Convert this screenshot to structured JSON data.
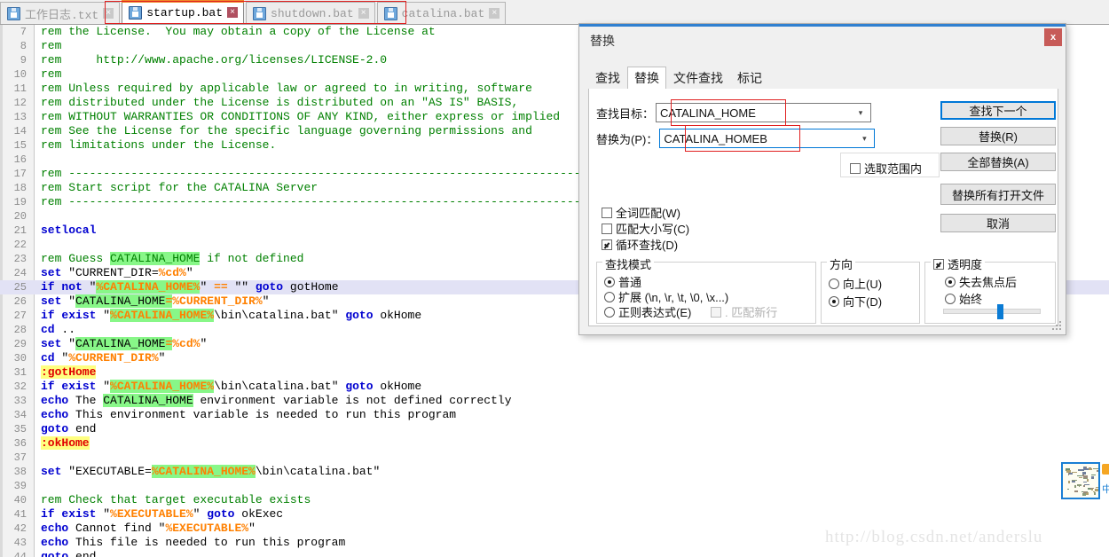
{
  "tabs": [
    {
      "label": "工作日志.txt",
      "active": false,
      "close": "×"
    },
    {
      "label": "startup.bat",
      "active": true,
      "close": "×"
    },
    {
      "label": "shutdown.bat",
      "active": false,
      "close": "×"
    },
    {
      "label": "catalina.bat",
      "active": false,
      "close": "×"
    }
  ],
  "editor": {
    "lines": [
      {
        "num": "7",
        "segs": [
          {
            "t": "rem the License.  You may obtain a copy of the License at",
            "c": "cm"
          }
        ]
      },
      {
        "num": "8",
        "segs": [
          {
            "t": "rem",
            "c": "cm"
          }
        ]
      },
      {
        "num": "9",
        "segs": [
          {
            "t": "rem     http://www.apache.org/licenses/LICENSE-2.0",
            "c": "cm"
          }
        ]
      },
      {
        "num": "10",
        "segs": [
          {
            "t": "rem",
            "c": "cm"
          }
        ]
      },
      {
        "num": "11",
        "segs": [
          {
            "t": "rem Unless required by applicable law or agreed to in writing, software",
            "c": "cm"
          }
        ]
      },
      {
        "num": "12",
        "segs": [
          {
            "t": "rem distributed under the License is distributed on an \"AS IS\" BASIS,",
            "c": "cm"
          }
        ]
      },
      {
        "num": "13",
        "segs": [
          {
            "t": "rem WITHOUT WARRANTIES OR CONDITIONS OF ANY KIND, either express or implied",
            "c": "cm"
          }
        ]
      },
      {
        "num": "14",
        "segs": [
          {
            "t": "rem See the License for the specific language governing permissions and",
            "c": "cm"
          }
        ]
      },
      {
        "num": "15",
        "segs": [
          {
            "t": "rem limitations under the License.",
            "c": "cm"
          }
        ]
      },
      {
        "num": "16",
        "segs": []
      },
      {
        "num": "17",
        "segs": [
          {
            "t": "rem ---------------------------------------------------------------------------",
            "c": "cm"
          }
        ]
      },
      {
        "num": "18",
        "segs": [
          {
            "t": "rem Start script for the CATALINA Server",
            "c": "cm"
          }
        ]
      },
      {
        "num": "19",
        "segs": [
          {
            "t": "rem ---------------------------------------------------------------------------",
            "c": "cm"
          }
        ]
      },
      {
        "num": "20",
        "segs": []
      },
      {
        "num": "21",
        "segs": [
          {
            "t": "setlocal",
            "c": "kw"
          }
        ]
      },
      {
        "num": "22",
        "segs": []
      },
      {
        "num": "23",
        "segs": [
          {
            "t": "rem Guess ",
            "c": "cm"
          },
          {
            "t": "CATALINA_HOME",
            "c": "cm hit"
          },
          {
            "t": " if not defined",
            "c": "cm"
          }
        ]
      },
      {
        "num": "24",
        "segs": [
          {
            "t": "set",
            "c": "kw"
          },
          {
            "t": " \"CURRENT_DIR=",
            "c": "plain"
          },
          {
            "t": "%cd%",
            "c": "var"
          },
          {
            "t": "\"",
            "c": "plain"
          }
        ]
      },
      {
        "num": "25",
        "current": true,
        "segs": [
          {
            "t": "if",
            "c": "kw"
          },
          {
            "t": " ",
            "c": "plain"
          },
          {
            "t": "not",
            "c": "kw"
          },
          {
            "t": " \"",
            "c": "plain"
          },
          {
            "t": "%CATALINA_HOME%",
            "c": "var hit"
          },
          {
            "t": "\" ",
            "c": "plain"
          },
          {
            "t": "==",
            "c": "var"
          },
          {
            "t": " \"\" ",
            "c": "plain"
          },
          {
            "t": "goto",
            "c": "kw"
          },
          {
            "t": " gotHome",
            "c": "plain"
          }
        ]
      },
      {
        "num": "26",
        "segs": [
          {
            "t": "set",
            "c": "kw"
          },
          {
            "t": " \"",
            "c": "plain"
          },
          {
            "t": "CATALINA_HOME",
            "c": "plain hit"
          },
          {
            "t": "=",
            "c": "var hit"
          },
          {
            "t": "%CURRENT_DIR%",
            "c": "var"
          },
          {
            "t": "\"",
            "c": "plain"
          }
        ]
      },
      {
        "num": "27",
        "segs": [
          {
            "t": "if",
            "c": "kw"
          },
          {
            "t": " ",
            "c": "plain"
          },
          {
            "t": "exist",
            "c": "kw"
          },
          {
            "t": " \"",
            "c": "plain"
          },
          {
            "t": "%CATALINA_HOME%",
            "c": "var hit"
          },
          {
            "t": "\\bin\\catalina.bat\" ",
            "c": "plain"
          },
          {
            "t": "goto",
            "c": "kw"
          },
          {
            "t": " okHome",
            "c": "plain"
          }
        ]
      },
      {
        "num": "28",
        "segs": [
          {
            "t": "cd",
            "c": "kw"
          },
          {
            "t": " ..",
            "c": "plain"
          }
        ]
      },
      {
        "num": "29",
        "segs": [
          {
            "t": "set",
            "c": "kw"
          },
          {
            "t": " \"",
            "c": "plain"
          },
          {
            "t": "CATALINA_HOME",
            "c": "plain hit"
          },
          {
            "t": "=",
            "c": "var hit"
          },
          {
            "t": "%cd%",
            "c": "var"
          },
          {
            "t": "\"",
            "c": "plain"
          }
        ]
      },
      {
        "num": "30",
        "segs": [
          {
            "t": "cd",
            "c": "kw"
          },
          {
            "t": " \"",
            "c": "plain"
          },
          {
            "t": "%CURRENT_DIR%",
            "c": "var"
          },
          {
            "t": "\"",
            "c": "plain"
          }
        ]
      },
      {
        "num": "31",
        "segs": [
          {
            "t": ":gotHome",
            "c": "lbl"
          }
        ]
      },
      {
        "num": "32",
        "segs": [
          {
            "t": "if",
            "c": "kw"
          },
          {
            "t": " ",
            "c": "plain"
          },
          {
            "t": "exist",
            "c": "kw"
          },
          {
            "t": " \"",
            "c": "plain"
          },
          {
            "t": "%CATALINA_HOME%",
            "c": "var hit"
          },
          {
            "t": "\\bin\\catalina.bat\" ",
            "c": "plain"
          },
          {
            "t": "goto",
            "c": "kw"
          },
          {
            "t": " okHome",
            "c": "plain"
          }
        ]
      },
      {
        "num": "33",
        "segs": [
          {
            "t": "echo",
            "c": "kw"
          },
          {
            "t": " The ",
            "c": "plain"
          },
          {
            "t": "CATALINA_HOME",
            "c": "plain hit"
          },
          {
            "t": " environment variable is not defined correctly",
            "c": "plain"
          }
        ]
      },
      {
        "num": "34",
        "segs": [
          {
            "t": "echo",
            "c": "kw"
          },
          {
            "t": " This environment variable is needed to run this program",
            "c": "plain"
          }
        ]
      },
      {
        "num": "35",
        "segs": [
          {
            "t": "goto",
            "c": "kw"
          },
          {
            "t": " end",
            "c": "plain"
          }
        ]
      },
      {
        "num": "36",
        "segs": [
          {
            "t": ":okHome",
            "c": "lbl"
          }
        ]
      },
      {
        "num": "37",
        "segs": []
      },
      {
        "num": "38",
        "segs": [
          {
            "t": "set",
            "c": "kw"
          },
          {
            "t": " \"EXECUTABLE=",
            "c": "plain"
          },
          {
            "t": "%CATALINA_HOME%",
            "c": "var hit"
          },
          {
            "t": "\\bin\\catalina.bat\"",
            "c": "plain"
          }
        ]
      },
      {
        "num": "39",
        "segs": []
      },
      {
        "num": "40",
        "segs": [
          {
            "t": "rem Check that target executable exists",
            "c": "cm"
          }
        ]
      },
      {
        "num": "41",
        "segs": [
          {
            "t": "if",
            "c": "kw"
          },
          {
            "t": " ",
            "c": "plain"
          },
          {
            "t": "exist",
            "c": "kw"
          },
          {
            "t": " \"",
            "c": "plain"
          },
          {
            "t": "%EXECUTABLE%",
            "c": "var"
          },
          {
            "t": "\" ",
            "c": "plain"
          },
          {
            "t": "goto",
            "c": "kw"
          },
          {
            "t": " okExec",
            "c": "plain"
          }
        ]
      },
      {
        "num": "42",
        "segs": [
          {
            "t": "echo",
            "c": "kw"
          },
          {
            "t": " Cannot find \"",
            "c": "plain"
          },
          {
            "t": "%EXECUTABLE%",
            "c": "var"
          },
          {
            "t": "\"",
            "c": "plain"
          }
        ]
      },
      {
        "num": "43",
        "segs": [
          {
            "t": "echo",
            "c": "kw"
          },
          {
            "t": " This file is needed to run this program",
            "c": "plain"
          }
        ]
      },
      {
        "num": "44",
        "segs": [
          {
            "t": "goto",
            "c": "kw"
          },
          {
            "t": " end",
            "c": "plain"
          }
        ]
      }
    ]
  },
  "watermark": "http://blog.csdn.net/anderslu",
  "side_widget": {
    "label": "中"
  },
  "dialog": {
    "title": "替换",
    "close_label": "x",
    "tabs": [
      {
        "label": "查找",
        "selected": false
      },
      {
        "label": "替换",
        "selected": true
      },
      {
        "label": "文件查找",
        "selected": false
      },
      {
        "label": "标记",
        "selected": false
      }
    ],
    "find_label": "查找目标：",
    "find_value": "CATALINA_HOME",
    "replace_label": "替换为(P)：",
    "replace_value": "CATALINA_HOMEB",
    "dropdown_icon": "chevron-down-icon",
    "in_selection": {
      "label": "选取范围内",
      "checked": false
    },
    "buttons": {
      "find_next": "查找下一个",
      "replace": "替换(R)",
      "replace_all": "全部替换(A)",
      "replace_all_open_files": "替换所有打开文件",
      "cancel": "取消"
    },
    "checkboxes": [
      {
        "label": "全词匹配(W)",
        "checked": false
      },
      {
        "label": "匹配大小写(C)",
        "checked": false
      },
      {
        "label": "循环查找(D)",
        "checked": true
      }
    ],
    "search_mode": {
      "title": "查找模式",
      "options": [
        {
          "label": "普通",
          "selected": true
        },
        {
          "label": "扩展 (\\n, \\r, \\t, \\0, \\x...)",
          "selected": false
        },
        {
          "label": "正则表达式(E)",
          "selected": false
        }
      ],
      "match_newline": {
        "label": ". 匹配新行",
        "checked": false,
        "disabled": true
      }
    },
    "direction": {
      "title": "方向",
      "options": [
        {
          "label": "向上(U)",
          "selected": false
        },
        {
          "label": "向下(D)",
          "selected": true
        }
      ]
    },
    "transparency": {
      "title": "透明度",
      "checked": true,
      "options": [
        {
          "label": "失去焦点后",
          "selected": true
        },
        {
          "label": "始终",
          "selected": false
        }
      ],
      "slider_percent": 58
    }
  }
}
